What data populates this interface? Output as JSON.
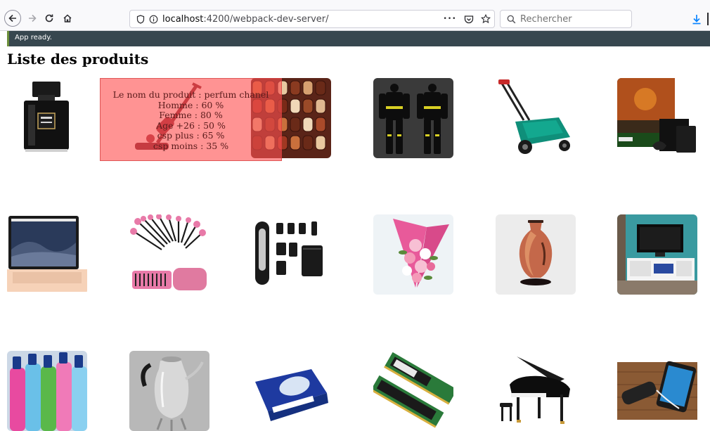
{
  "browser": {
    "url_host": "localhost",
    "url_path": ":4200/webpack-dev-server/",
    "search_placeholder": "Rechercher",
    "more_actions_label": "•••"
  },
  "app": {
    "status_text": "App ready."
  },
  "page": {
    "title": "Liste des produits"
  },
  "tooltip": {
    "product_name": "Le nom du produit : perfum chanel",
    "stats": [
      "Homme : 60 %",
      "Femme : 80 %",
      "Age +26 : 50 %",
      "csp plus : 65 %",
      "csp moins : 35 %"
    ]
  },
  "products": [
    {
      "icon": "perfume-bottle-icon"
    },
    {
      "icon": "vacuum-cleaner-icon"
    },
    {
      "icon": "chocolates-icon"
    },
    {
      "icon": "racing-suit-icon"
    },
    {
      "icon": "lawn-mower-icon"
    },
    {
      "icon": "game-console-icon"
    },
    {
      "icon": "laptop-icon"
    },
    {
      "icon": "makeup-brushes-icon"
    },
    {
      "icon": "trimmer-kit-icon"
    },
    {
      "icon": "flower-bouquet-icon"
    },
    {
      "icon": "vase-icon"
    },
    {
      "icon": "tv-stand-icon"
    },
    {
      "icon": "cleaning-sprays-icon"
    },
    {
      "icon": "silver-coffee-pot-icon"
    },
    {
      "icon": "paper-ream-icon"
    },
    {
      "icon": "ram-modules-icon"
    },
    {
      "icon": "grand-piano-icon"
    },
    {
      "icon": "power-bank-icon"
    }
  ],
  "colors": {
    "app_bar": "#37474f",
    "tooltip": "#ff5050",
    "download_icon": "#0a84ff"
  }
}
